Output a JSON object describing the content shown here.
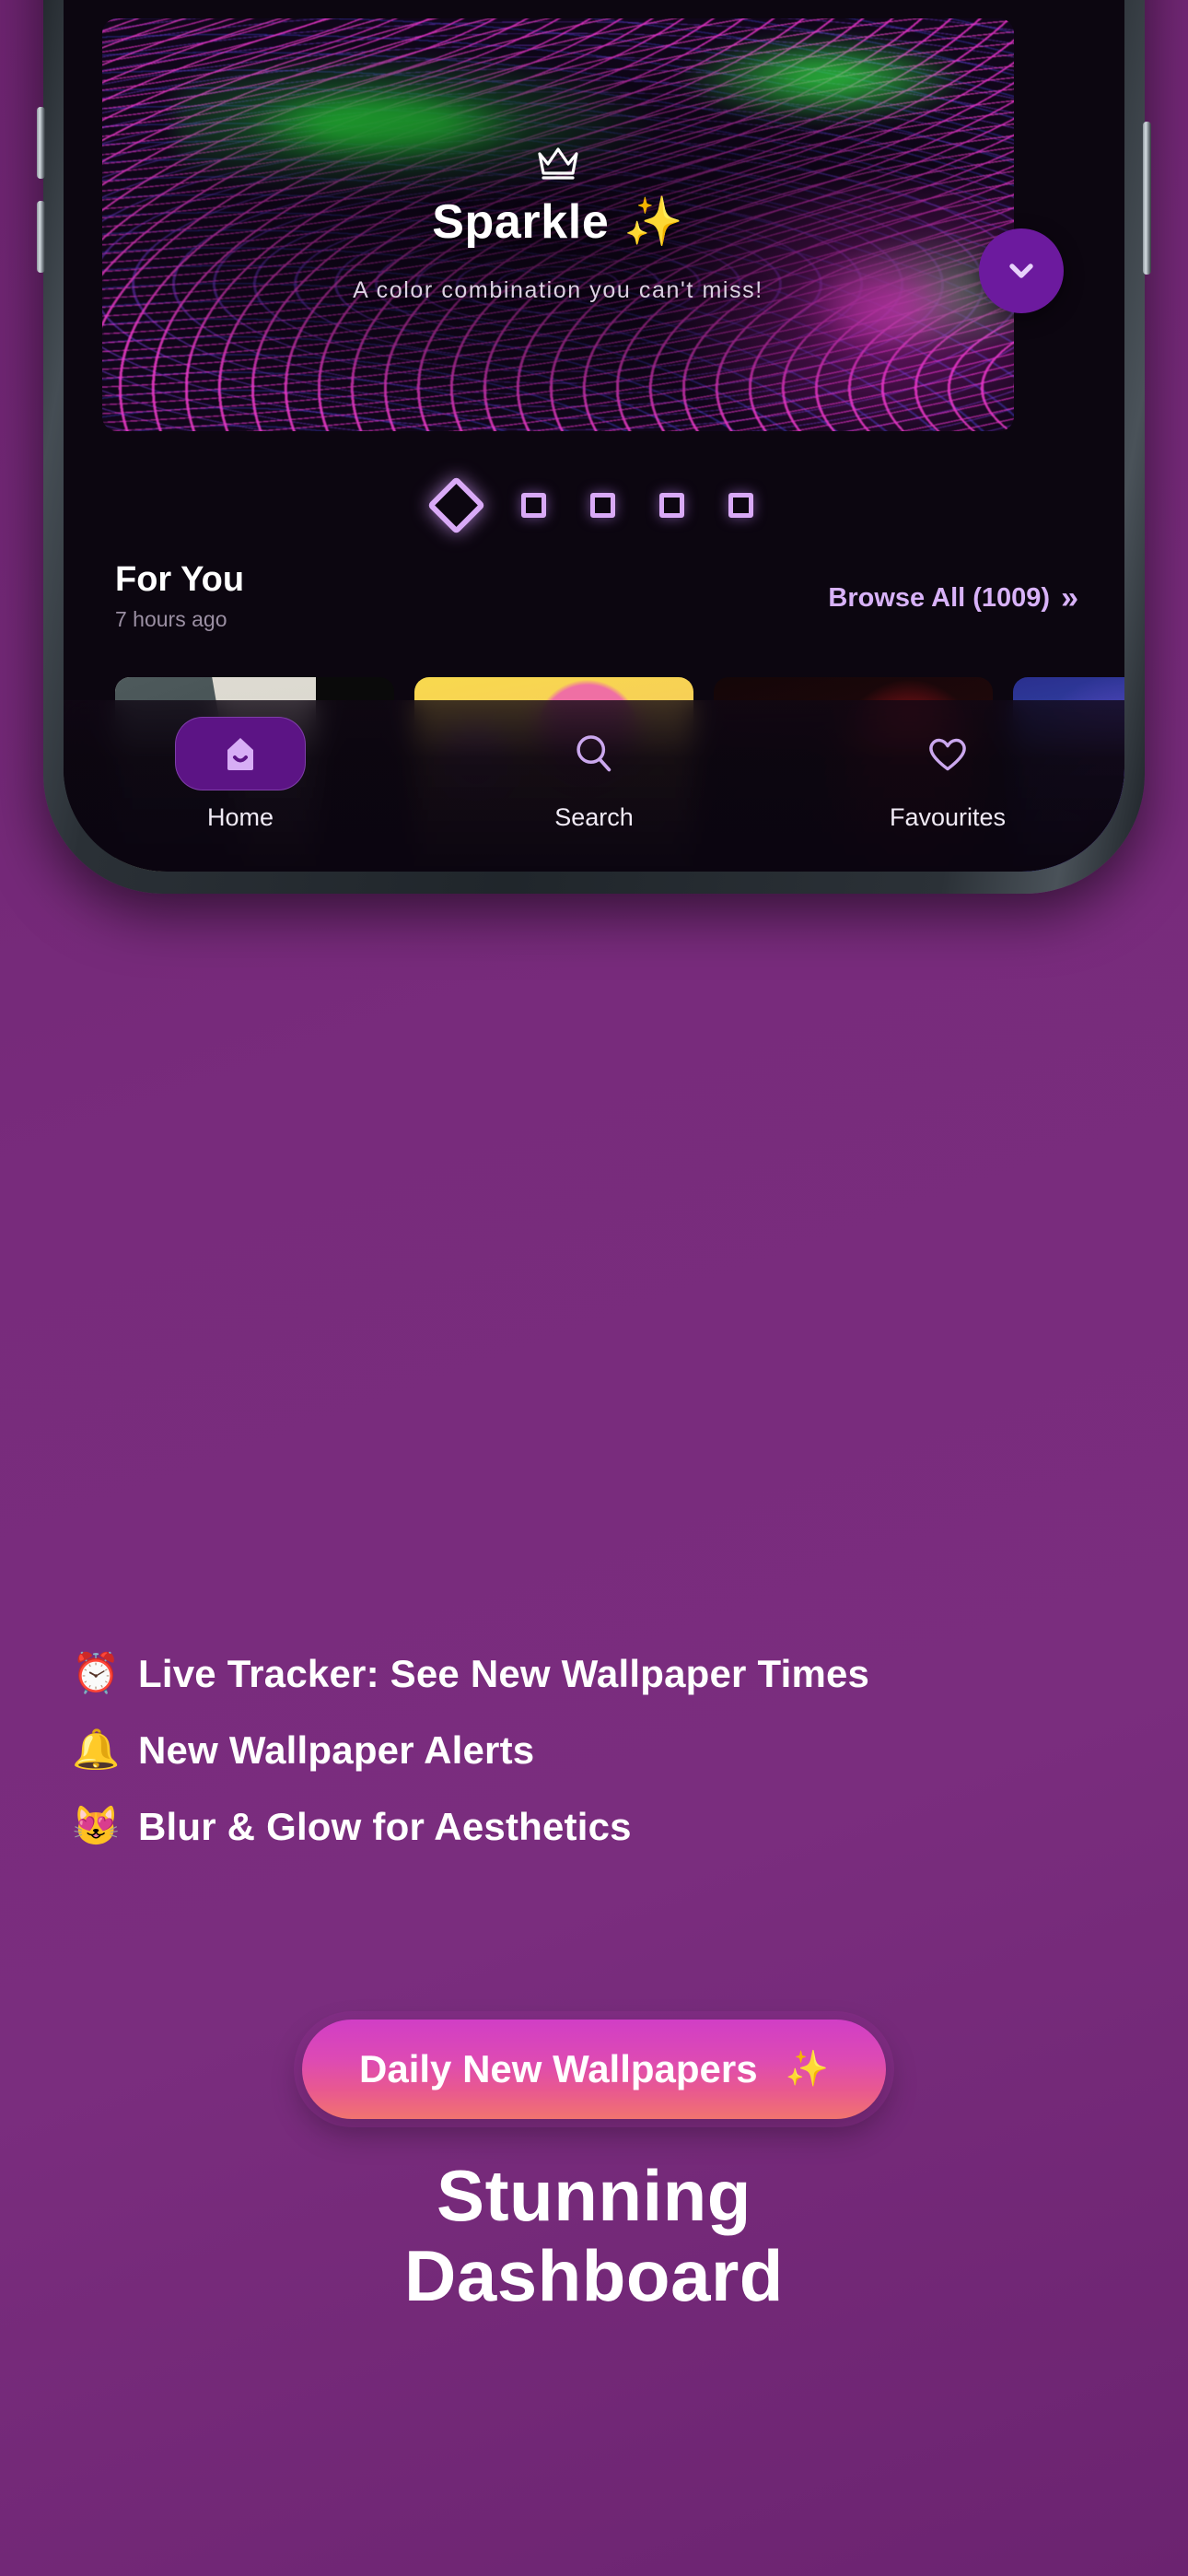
{
  "colors": {
    "page_background_purple": "#782b7c",
    "app_background": "#0c0610",
    "accent_lavender": "#d8b2f8",
    "accent_purple": "#5c1485",
    "fab_purple": "#6c1a9e",
    "cta_gradient_start": "#d13ec6",
    "cta_gradient_end": "#f1746f"
  },
  "phone": {
    "buttons": {
      "volume_up": "volume-up-button",
      "volume_down": "volume-down-button",
      "power": "power-button"
    }
  },
  "app": {
    "hero": {
      "crown_icon": "crown-icon",
      "title": "Sparkle",
      "title_sparkle": "✨",
      "subtitle": "A color combination you can't miss!"
    },
    "pagination": {
      "total": 5,
      "active_index": 0,
      "active_shape": "diamond",
      "inactive_shape": "square"
    },
    "for_you": {
      "title": "For You",
      "timestamp": "7 hours ago",
      "browse_all_label": "Browse All (1009)",
      "browse_all_icon": "double-chevron-right-icon",
      "count": 1009
    },
    "wallpapers": [
      {
        "name": "mountain-fjord-sunset"
      },
      {
        "name": "kawaii-pastel-bears"
      },
      {
        "name": "dark-red-hero-portrait"
      },
      {
        "name": "blue-purple-nebula"
      }
    ],
    "scroll_down_fab": {
      "icon": "chevron-down-icon"
    },
    "bottom_nav": [
      {
        "label": "Home",
        "icon": "home-icon",
        "active": true
      },
      {
        "label": "Search",
        "icon": "search-icon",
        "active": false
      },
      {
        "label": "Favourites",
        "icon": "heart-icon",
        "active": false
      }
    ]
  },
  "features": [
    {
      "emoji": "⏰",
      "emoji_name": "alarm-clock-emoji",
      "text": "Live Tracker: See New Wallpaper Times"
    },
    {
      "emoji": "🔔",
      "emoji_name": "bell-emoji",
      "text": "New Wallpaper Alerts"
    },
    {
      "emoji": "😻",
      "emoji_name": "heart-eyes-cat-emoji",
      "text": "Blur & Glow for Aesthetics"
    }
  ],
  "cta": {
    "label": "Daily New Wallpapers",
    "sparkle": "✨"
  },
  "headline": {
    "line1": "Stunning",
    "line2": "Dashboard"
  }
}
